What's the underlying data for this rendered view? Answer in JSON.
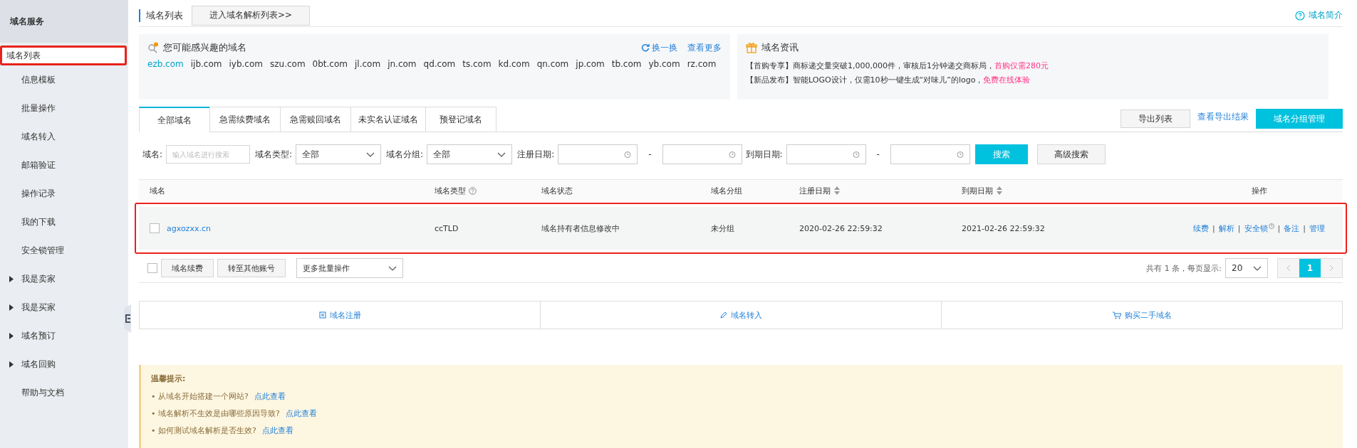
{
  "sidebar": {
    "title": "域名服务",
    "items": [
      {
        "label": "域名列表",
        "selected": true,
        "annotated": true,
        "expandable": false
      },
      {
        "label": "信息模板",
        "selected": false,
        "annotated": false,
        "expandable": false
      },
      {
        "label": "批量操作",
        "selected": false,
        "annotated": false,
        "expandable": false
      },
      {
        "label": "域名转入",
        "selected": false,
        "annotated": false,
        "expandable": false
      },
      {
        "label": "邮箱验证",
        "selected": false,
        "annotated": false,
        "expandable": false
      },
      {
        "label": "操作记录",
        "selected": false,
        "annotated": false,
        "expandable": false
      },
      {
        "label": "我的下载",
        "selected": false,
        "annotated": false,
        "expandable": false
      },
      {
        "label": "安全锁管理",
        "selected": false,
        "annotated": false,
        "expandable": false
      },
      {
        "label": "我是卖家",
        "selected": false,
        "annotated": false,
        "expandable": true
      },
      {
        "label": "我是买家",
        "selected": false,
        "annotated": false,
        "expandable": true
      },
      {
        "label": "域名预订",
        "selected": false,
        "annotated": false,
        "expandable": true
      },
      {
        "label": "域名回购",
        "selected": false,
        "annotated": false,
        "expandable": true
      },
      {
        "label": "帮助与文档",
        "selected": false,
        "annotated": false,
        "expandable": false
      }
    ]
  },
  "header": {
    "title": "域名列表",
    "button": "进入域名解析列表>>",
    "help_link": "域名简介"
  },
  "suggest": {
    "title": "您可能感兴趣的域名",
    "refresh": "换一换",
    "more": "查看更多",
    "domains": [
      {
        "name": "ezb.com",
        "highlight": true
      },
      {
        "name": "ijb.com",
        "highlight": false
      },
      {
        "name": "iyb.com",
        "highlight": false
      },
      {
        "name": "szu.com",
        "highlight": false
      },
      {
        "name": "0bt.com",
        "highlight": false
      },
      {
        "name": "jl.com",
        "highlight": false
      },
      {
        "name": "jn.com",
        "highlight": false
      },
      {
        "name": "qd.com",
        "highlight": false
      },
      {
        "name": "ts.com",
        "highlight": false
      },
      {
        "name": "kd.com",
        "highlight": false
      },
      {
        "name": "qn.com",
        "highlight": false
      },
      {
        "name": "jp.com",
        "highlight": false
      },
      {
        "name": "tb.com",
        "highlight": false
      },
      {
        "name": "yb.com",
        "highlight": false
      },
      {
        "name": "rz.com",
        "highlight": false
      }
    ]
  },
  "news": {
    "title": "域名资讯",
    "items": [
      {
        "text": "【首购专享】商标递交量突破1,000,000件，审核后1分钟递交商标局，",
        "link": "首购仅需280元"
      },
      {
        "text": "【新品发布】智能LOGO设计，仅需10秒一键生成“对味儿”的logo，",
        "link": "免费在线体验"
      }
    ]
  },
  "tabs": [
    {
      "label": "全部域名",
      "selected": true
    },
    {
      "label": "急需续费域名",
      "selected": false
    },
    {
      "label": "急需赎回域名",
      "selected": false
    },
    {
      "label": "未实名认证域名",
      "selected": false
    },
    {
      "label": "预登记域名",
      "selected": false
    }
  ],
  "tab_actions": {
    "export": "导出列表",
    "view_export": "查看导出结果",
    "group_manage": "域名分组管理"
  },
  "filters": {
    "domain_label": "域名:",
    "domain_placeholder": "输入域名进行搜索",
    "type_label": "域名类型:",
    "type_value": "全部",
    "group_label": "域名分组:",
    "group_value": "全部",
    "reg_label": "注册日期:",
    "reg_sep": "-",
    "exp_label": "到期日期:",
    "exp_sep": "-",
    "search": "搜索",
    "advanced": "高级搜索"
  },
  "table": {
    "columns": [
      {
        "label": "域名",
        "help": false,
        "sortable": false
      },
      {
        "label": "域名类型",
        "help": true,
        "sortable": false
      },
      {
        "label": "域名状态",
        "help": false,
        "sortable": false
      },
      {
        "label": "域名分组",
        "help": false,
        "sortable": false
      },
      {
        "label": "注册日期",
        "help": false,
        "sortable": true
      },
      {
        "label": "到期日期",
        "help": false,
        "sortable": true
      },
      {
        "label": "操作",
        "help": false,
        "sortable": false
      }
    ],
    "rows": [
      {
        "checked": false,
        "annotated": true,
        "domain": "agxozxx.cn",
        "type": "ccTLD",
        "status": "域名持有者信息修改中",
        "group": "未分组",
        "registered": "2020-02-26 22:59:32",
        "expires": "2021-02-26 22:59:32",
        "actions": [
          {
            "label": "续费",
            "help": false
          },
          {
            "label": "解析",
            "help": false
          },
          {
            "label": "安全锁",
            "help": true
          },
          {
            "label": "备注",
            "help": false
          },
          {
            "label": "管理",
            "help": false
          }
        ],
        "separator": "|"
      }
    ]
  },
  "batch": {
    "checked": false,
    "buttons": [
      "域名续费",
      "转至其他账号"
    ],
    "more": "更多批量操作",
    "summary": "共有 1 条，每页显示:",
    "page_size": "20",
    "pages": [
      {
        "label": "1",
        "selected": true
      }
    ]
  },
  "quick_links": [
    {
      "label": "域名注册",
      "kind": "register"
    },
    {
      "label": "域名转入",
      "kind": "transfer"
    },
    {
      "label": "购买二手域名",
      "kind": "buy"
    }
  ],
  "tips": {
    "title": "温馨提示:",
    "items": [
      {
        "text": "• 从域名开始搭建一个网站?",
        "link": "点此查看"
      },
      {
        "text": "• 域名解析不生效是由哪些原因导致?",
        "link": "点此查看"
      },
      {
        "text": "• 如何测试域名解析是否生效?",
        "link": "点此查看"
      }
    ]
  }
}
